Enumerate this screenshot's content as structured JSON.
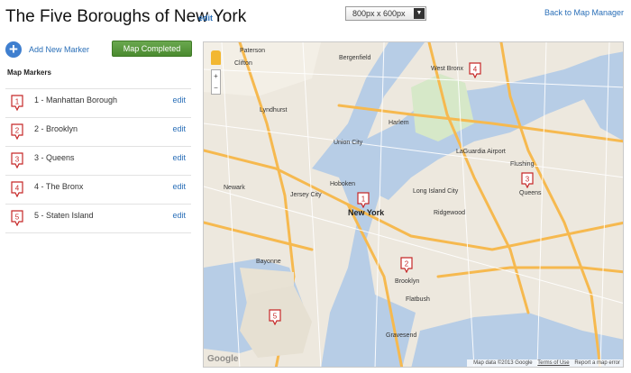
{
  "page": {
    "title": "The Five Boroughs of New York",
    "title_edit": "edit",
    "size_select_value": "800px x 600px",
    "back_link": "Back to Map Manager"
  },
  "toolbar": {
    "add_marker_label": "Add New Marker",
    "map_completed_label": "Map Completed"
  },
  "markers": {
    "heading": "Map Markers",
    "items": [
      {
        "number": "1",
        "label": "1 - Manhattan Borough",
        "edit": "edit"
      },
      {
        "number": "2",
        "label": "2 - Brooklyn",
        "edit": "edit"
      },
      {
        "number": "3",
        "label": "3 - Queens",
        "edit": "edit"
      },
      {
        "number": "4",
        "label": "4 - The Bronx",
        "edit": "edit"
      },
      {
        "number": "5",
        "label": "5 - Staten Island",
        "edit": "edit"
      }
    ]
  },
  "map": {
    "zoom_in": "+",
    "zoom_out": "−",
    "google_logo": "Google",
    "attribution": "Map data ©2013 Google",
    "terms": "Terms of Use",
    "report": "Report a map error",
    "labels": {
      "clifton": "Clifton",
      "paterson": "Paterson",
      "west_bronx": "West Bronx",
      "lyndhurst": "Lyndhurst",
      "bergenfield": "Bergenfield",
      "union_city": "Union City",
      "harlem": "Harlem",
      "newark": "Newark",
      "jersey_city": "Jersey City",
      "hoboken": "Hoboken",
      "new_york": "New York",
      "laguardia": "LaGuardia Airport",
      "queens": "Queens",
      "brooklyn": "Brooklyn",
      "flatbush": "Flatbush",
      "bayonne": "Bayonne",
      "gravesend": "Gravesend",
      "flushing": "Flushing",
      "ridgewood": "Ridgewood",
      "long_island_city": "Long Island City"
    }
  }
}
